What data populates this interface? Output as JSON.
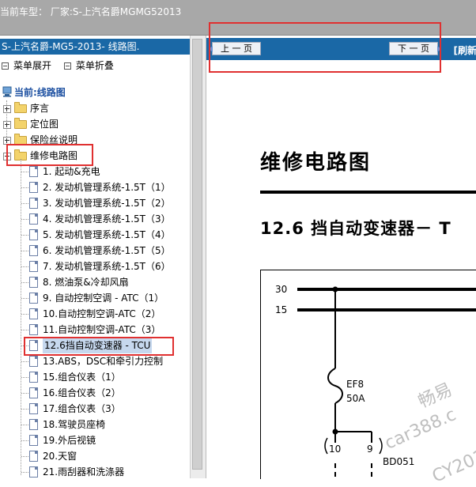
{
  "topbar": {
    "title": "当前车型：  厂家:S-上汽名爵MGMG52013"
  },
  "left": {
    "header": "S-上汽名爵-MG5-2013- 线路图.",
    "expand_all": "菜单展开",
    "collapse_all": "菜单折叠",
    "current": "当前:线路图",
    "folders": [
      {
        "label": "序言",
        "state": "collapsed"
      },
      {
        "label": "定位图",
        "state": "collapsed"
      },
      {
        "label": "保险丝说明",
        "state": "collapsed"
      },
      {
        "label": "维修电路图",
        "state": "expanded"
      }
    ],
    "items": [
      "1. 起动&充电",
      "2. 发动机管理系统-1.5T（1）",
      "3. 发动机管理系统-1.5T（2）",
      "4. 发动机管理系统-1.5T（3）",
      "5. 发动机管理系统-1.5T（4）",
      "6. 发动机管理系统-1.5T（5）",
      "7. 发动机管理系统-1.5T（6）",
      "8. 燃油泵&冷却风扇",
      "9. 自动控制空调 - ATC（1）",
      "10.自动控制空调-ATC（2）",
      "11.自动控制空调-ATC（3）",
      "12.6挡自动变速器 - TCU",
      "13.ABS，DSC和牵引力控制",
      "15.组合仪表（1）",
      "16.组合仪表（2）",
      "17.组合仪表（3）",
      "18.驾驶员座椅",
      "19.外后视镜",
      "20.天窗",
      "21.雨刮器和洗涤器"
    ],
    "selected_index": 11
  },
  "right": {
    "prev_label": "上 一 页",
    "next_label": "下 一 页",
    "refresh_label": "[刷新",
    "doc_title": "维修电路图",
    "doc_subtitle": "12.6 挡自动变速器－ T",
    "diagram": {
      "rail1": "30",
      "rail2": "15",
      "fuse_name": "EF8",
      "fuse_rating": "50A",
      "pin_left": "10",
      "pin_right": "9",
      "connector": "BD051"
    },
    "watermark_line1": "畅易",
    "watermark_line2": "car388.c",
    "watermark_line3": "CY201"
  },
  "colors": {
    "header_blue": "#1a68a6",
    "highlight_red": "#e03030",
    "topbar_gray": "#a8a8a8"
  }
}
